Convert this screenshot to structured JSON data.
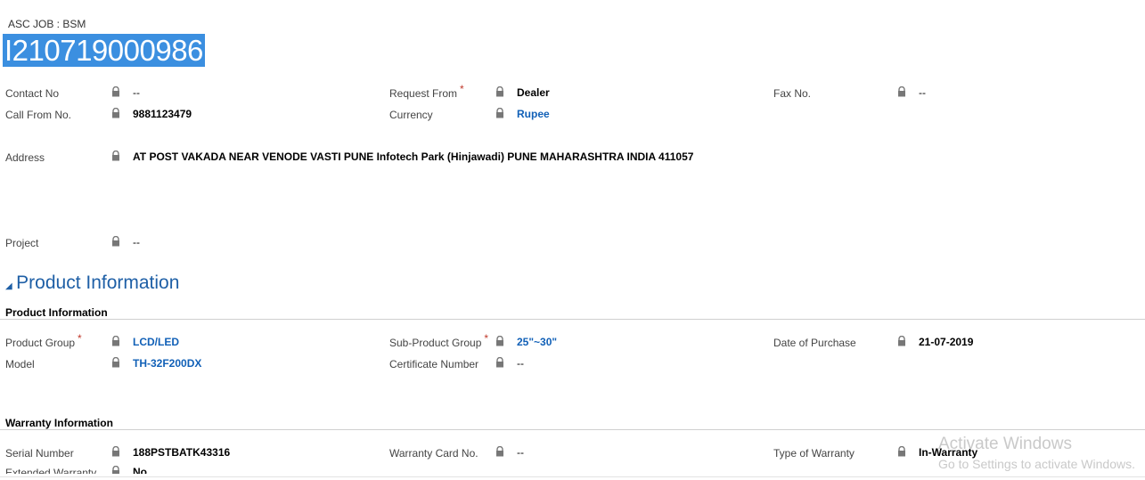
{
  "header": {
    "entity_type": "ASC JOB : BSM",
    "job_number": "I210719000986"
  },
  "general": {
    "contact_no": {
      "label": "Contact No",
      "value": "--"
    },
    "call_from_no": {
      "label": "Call From No.",
      "value": "9881123479"
    },
    "request_from": {
      "label": "Request From",
      "value": "Dealer",
      "required": "*"
    },
    "currency": {
      "label": "Currency",
      "value": "Rupee"
    },
    "fax_no": {
      "label": "Fax No.",
      "value": "--"
    },
    "address": {
      "label": "Address",
      "value": "AT POST VAKADA NEAR VENODE VASTI PUNE Infotech Park (Hinjawadi) PUNE MAHARASHTRA INDIA 411057"
    },
    "project": {
      "label": "Project",
      "value": "--"
    }
  },
  "product_section": {
    "title": "Product Information",
    "subheading": "Product Information",
    "product_group": {
      "label": "Product Group",
      "value": "LCD/LED",
      "required": "*"
    },
    "model": {
      "label": "Model",
      "value": "TH-32F200DX"
    },
    "sub_product_group": {
      "label": "Sub-Product Group",
      "value": "25\"~30\"",
      "required": "*"
    },
    "certificate_number": {
      "label": "Certificate Number",
      "value": "--"
    },
    "date_of_purchase": {
      "label": "Date of Purchase",
      "value": "21-07-2019"
    }
  },
  "warranty": {
    "subheading": "Warranty Information",
    "serial_number": {
      "label": "Serial Number",
      "value": "188PSTBATK43316"
    },
    "warranty_card_no": {
      "label": "Warranty Card No.",
      "value": "--"
    },
    "type_of_warranty": {
      "label": "Type of Warranty",
      "value": "In-Warranty"
    },
    "extended_warranty": {
      "label": "Extended Warranty",
      "value": "No"
    }
  },
  "watermark": {
    "line1": "Activate Windows",
    "line2": "Go to Settings to activate Windows."
  },
  "icons": {
    "lock": "lock-icon",
    "collapse": "collapse-triangle-icon"
  },
  "colors": {
    "link": "#1160b7",
    "section": "#1e5fa6",
    "selection": "#3b8fe0",
    "required": "#c0392b"
  }
}
